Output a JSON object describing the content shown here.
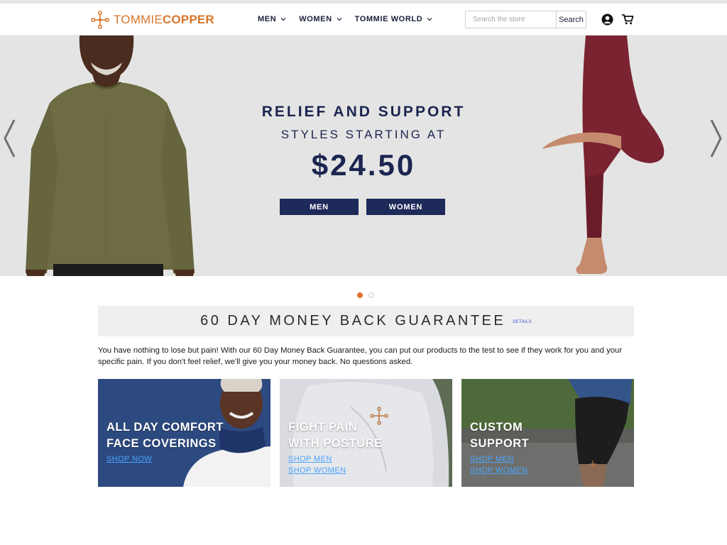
{
  "brand": {
    "name_part1": "TOMMIE",
    "name_part2": "COPPER",
    "color": "#d9762b"
  },
  "nav": {
    "items": [
      {
        "label": "MEN"
      },
      {
        "label": "WOMEN"
      },
      {
        "label": "TOMMIE WORLD"
      }
    ]
  },
  "search": {
    "placeholder": "Search the store",
    "value": "",
    "button_label": "Search"
  },
  "icons": {
    "account": "user-icon",
    "cart": "cart-icon",
    "prev": "chevron-left-icon",
    "next": "chevron-right-icon"
  },
  "hero": {
    "headline": "RELIEF AND SUPPORT",
    "subheadline": "STYLES STARTING AT",
    "price": "$24.50",
    "buttons": [
      {
        "label": "MEN"
      },
      {
        "label": "WOMEN"
      }
    ],
    "slide_count": 2,
    "active_slide": 1,
    "colors": {
      "navy": "#1c2550",
      "dot_active": "#e3722e"
    }
  },
  "guarantee": {
    "title": "60 DAY MONEY BACK GUARANTEE",
    "details_label": "DETAILS",
    "body": "You have nothing to lose but pain! With our 60 Day Money Back Guarantee, you can put our products to the test to see if they work for you and your specific pain. If you don't feel relief, we'll give you your money back. No questions asked."
  },
  "tiles": [
    {
      "title_line1": "ALL DAY COMFORT",
      "title_line2": "FACE COVERINGS",
      "links": [
        "SHOP NOW"
      ]
    },
    {
      "title_line1": "FIGHT PAIN",
      "title_line2": "WITH POSTURE",
      "links": [
        "SHOP MEN",
        "SHOP WOMEN"
      ]
    },
    {
      "title_line1": "CUSTOM",
      "title_line2": "SUPPORT",
      "links": [
        "SHOP MEN",
        "SHOP WOMEN"
      ]
    }
  ]
}
